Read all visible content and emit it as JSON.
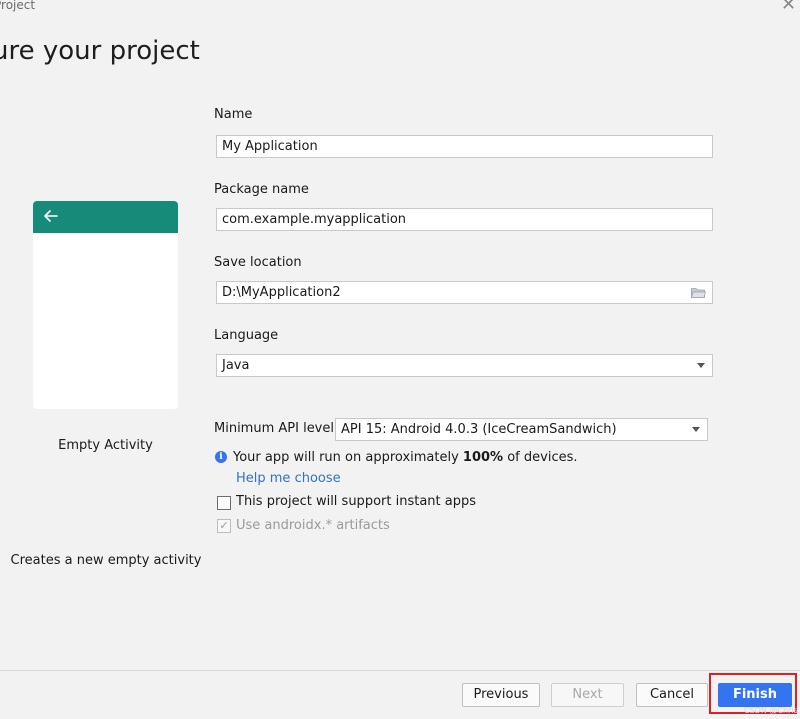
{
  "window": {
    "title": "Project",
    "close_icon": "close-icon"
  },
  "page_title": "ure your project",
  "template": {
    "name": "Empty Activity",
    "description": "Creates a new empty activity",
    "icon": "back-arrow-icon",
    "accent_color": "#178b7a"
  },
  "form": {
    "name_label": "Name",
    "name_value": "My Application",
    "package_label": "Package name",
    "package_value": "com.example.myapplication",
    "location_label": "Save location",
    "location_value": "D:\\MyApplication2",
    "location_icon": "folder-icon",
    "language_label": "Language",
    "language_value": "Java",
    "min_api_label": "Minimum API level",
    "min_api_value": "API 15: Android 4.0.3 (IceCreamSandwich)"
  },
  "info": {
    "icon": "info-icon",
    "prefix": "Your app will run on approximately ",
    "percent": "100%",
    "suffix": " of devices.",
    "help_link": "Help me choose"
  },
  "options": {
    "instant_apps_label": "This project will support instant apps",
    "instant_apps_checked": false,
    "androidx_label": "Use androidx.* artifacts",
    "androidx_checked": true,
    "androidx_enabled": false
  },
  "footer": {
    "previous_label": "Previous",
    "next_label": "Next",
    "cancel_label": "Cancel",
    "finish_label": "Finish",
    "primary_color": "#3574f0",
    "highlight_color": "#e02020"
  },
  "watermark": "CSDN @Chris"
}
